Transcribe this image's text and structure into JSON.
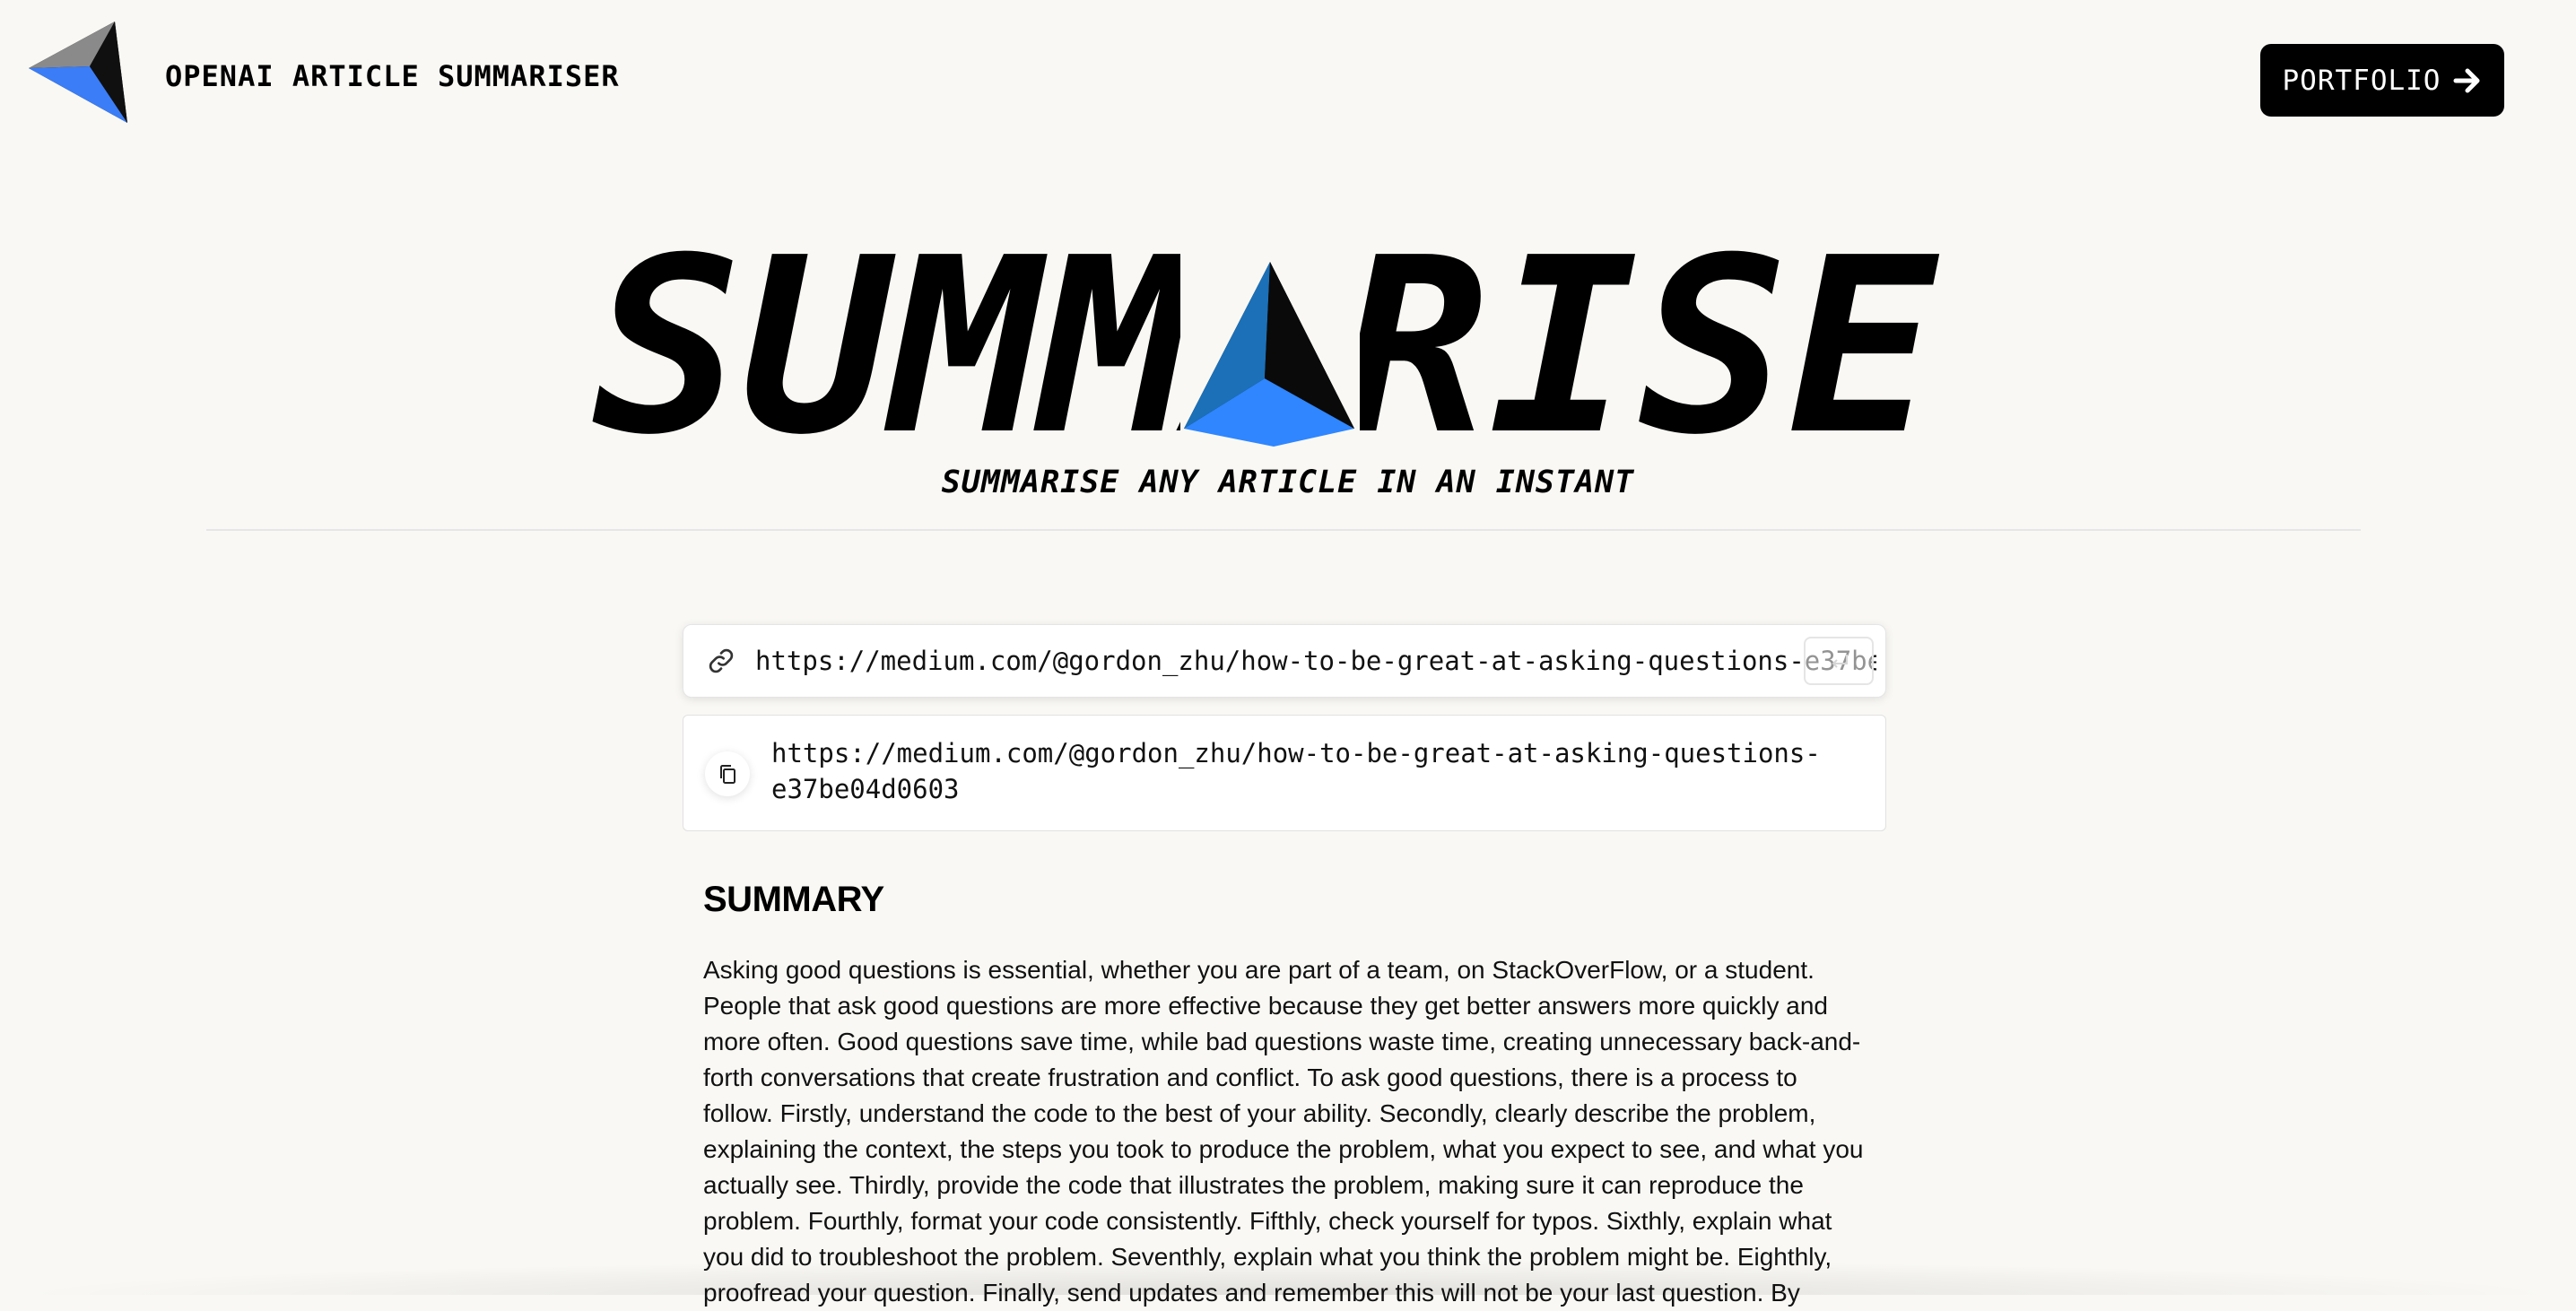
{
  "header": {
    "app_name": "OPENAI ARTICLE SUMMARISER",
    "portfolio_label": "PORTFOLIO",
    "portfolio_icon": "arrow-right-icon",
    "logo_icon": "triangle-logo-icon"
  },
  "hero": {
    "title": "SUMMARISE",
    "tagline": "SUMMARISE ANY ARTICLE IN AN INSTANT",
    "title_logo_icon": "triangle-logo-icon"
  },
  "form": {
    "link_icon": "link-icon",
    "url_value": "https://medium.com/@gordon_zhu/how-to-be-great-at-asking-questions-e37be04d0603",
    "submit_icon": "enter-icon"
  },
  "history": {
    "items": [
      {
        "url": "https://medium.com/@gordon_zhu/how-to-be-great-at-asking-questions-e37be04d0603",
        "copy_icon": "copy-icon"
      }
    ]
  },
  "summary": {
    "heading": "SUMMARY",
    "text": "Asking good questions is essential, whether you are part of a team, on StackOverFlow, or a student. People that ask good questions are more effective because they get better answers more quickly and more often. Good questions save time, while bad questions waste time, creating unnecessary back-and-forth conversations that create frustration and conflict. To ask good questions, there is a process to follow. Firstly, understand the code to the best of your ability. Secondly, clearly describe the problem, explaining the context, the steps you took to produce the problem, what you expect to see, and what you actually see. Thirdly, provide the code that illustrates the problem, making sure it can reproduce the problem. Fourthly, format your code consistently. Fifthly, check yourself for typos. Sixthly, explain what you did to troubleshoot the problem. Seventhly, explain what you think the problem might be. Eighthly, proofread your question. Finally, send updates and remember this will not be your last question. By"
  },
  "colors": {
    "background": "#f9f8f4",
    "accent_blue": "#2f86ff",
    "accent_steel": "#1b70b8",
    "text": "#000000"
  }
}
